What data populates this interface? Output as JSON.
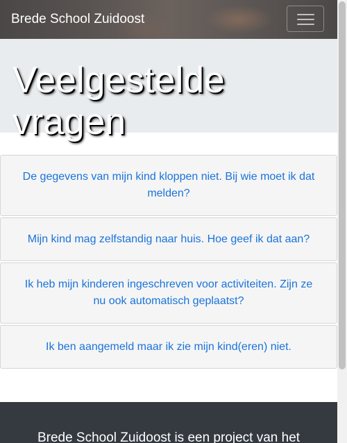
{
  "navbar": {
    "brand": "Brede School Zuidoost",
    "toggle_icon": "hamburger-menu-icon"
  },
  "hero": {
    "title": "Veelgestelde vragen"
  },
  "faq": {
    "items": [
      {
        "question": "De gegevens van mijn kind kloppen niet. Bij wie moet ik dat melden?"
      },
      {
        "question": "Mijn kind mag zelfstandig naar huis. Hoe geef ik dat aan?"
      },
      {
        "question": "Ik heb mijn kinderen ingeschreven voor activiteiten. Zijn ze nu ook automatisch geplaatst?"
      },
      {
        "question": "Ik ben aangemeld maar ik zie mijn kind(eren) niet."
      }
    ]
  },
  "footer": {
    "text": "Brede School Zuidoost is een project van het"
  },
  "colors": {
    "link": "#1a73d9",
    "footer_bg": "#343a40",
    "hero_bg": "#e9ecef",
    "card_bg": "#f5f5f5"
  }
}
